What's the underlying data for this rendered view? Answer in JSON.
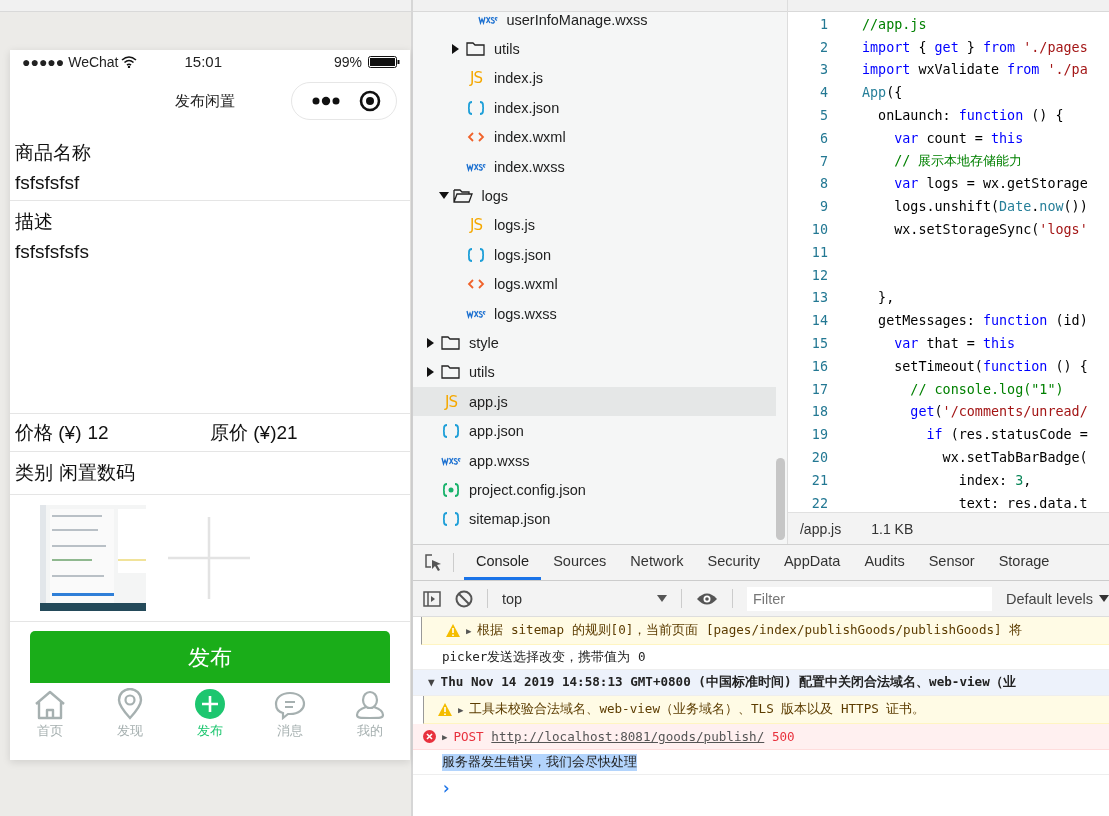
{
  "simulator": {
    "status_bar": {
      "carrier": "●●●●● WeChat",
      "time": "15:01",
      "battery": "99%"
    },
    "nav_bar": {
      "title": "发布闲置"
    },
    "form": {
      "name_field": {
        "label": "商品名称",
        "value": "fsfsfsfsf"
      },
      "description_field": {
        "label": "描述",
        "value": "fsfsfsfsfs"
      },
      "price_field": {
        "label": "价格 (¥)",
        "value": "12"
      },
      "original_price_field": {
        "label": "原价 (¥)",
        "value": "21"
      },
      "category_field": {
        "label": "类别",
        "value": "闲置数码"
      },
      "submit_button": "发布"
    },
    "tab_bar": [
      {
        "label": "首页",
        "selected": false
      },
      {
        "label": "发现",
        "selected": false
      },
      {
        "label": "发布",
        "selected": true
      },
      {
        "label": "消息",
        "selected": false
      },
      {
        "label": "我的",
        "selected": false
      }
    ]
  },
  "file_tree": [
    [
      [
        [
          {
            "kind": "wxss",
            "label": "userInfoManage.wxss",
            "selected": false
          }
        ],
        {
          "kind": "folder",
          "label": "utils",
          "expanded": false,
          "selected": false
        },
        {
          "kind": "js",
          "badge": "JS",
          "label": "index.js",
          "selected": false
        },
        {
          "kind": "json",
          "label": "index.json",
          "selected": false
        },
        {
          "kind": "wxml",
          "label": "index.wxml",
          "selected": false
        },
        {
          "kind": "wxss",
          "label": "index.wxss",
          "selected": false
        }
      ],
      {
        "kind": "folder",
        "label": "logs",
        "expanded": true,
        "selected": false,
        "children": [
          {
            "kind": "js",
            "badge": "JS",
            "label": "logs.js",
            "selected": false
          },
          {
            "kind": "json",
            "label": "logs.json",
            "selected": false
          },
          {
            "kind": "wxml",
            "label": "logs.wxml",
            "selected": false
          },
          {
            "kind": "wxss",
            "label": "logs.wxss",
            "selected": false
          }
        ]
      }
    ],
    {
      "kind": "folder",
      "label": "style",
      "expanded": false,
      "selected": false
    },
    {
      "kind": "folder",
      "label": "utils",
      "expanded": false,
      "selected": false
    },
    {
      "kind": "js",
      "badge": "JS",
      "label": "app.js",
      "selected": true
    },
    {
      "kind": "json",
      "label": "app.json",
      "selected": false
    },
    {
      "kind": "wxss",
      "label": "app.wxss",
      "selected": false
    },
    {
      "kind": "config",
      "label": "project.config.json",
      "selected": false
    },
    {
      "kind": "json",
      "label": "sitemap.json",
      "selected": false
    }
  ],
  "editor": {
    "lines": [
      {
        "number": "1",
        "tokens": [
          {
            "kind": "comment",
            "text": "//app.js"
          }
        ]
      },
      {
        "number": "2",
        "tokens": [
          {
            "kind": "keyword",
            "text": "import"
          },
          {
            "kind": "plain",
            "text": " { "
          },
          {
            "kind": "keyword",
            "text": "get"
          },
          {
            "kind": "plain",
            "text": " } "
          },
          {
            "kind": "keyword",
            "text": "from "
          },
          {
            "kind": "string",
            "text": "'./pages"
          }
        ]
      },
      {
        "number": "3",
        "tokens": [
          {
            "kind": "keyword",
            "text": "import"
          },
          {
            "kind": "plain",
            "text": " wxValidate "
          },
          {
            "kind": "keyword",
            "text": "from "
          },
          {
            "kind": "string",
            "text": "'./pa"
          }
        ]
      },
      {
        "number": "4",
        "tokens": [
          {
            "kind": "builtin",
            "text": "App"
          },
          {
            "kind": "plain",
            "text": "({"
          }
        ]
      },
      {
        "number": "5",
        "tokens": [
          {
            "kind": "plain",
            "text": "  onLaunch: "
          },
          {
            "kind": "keyword",
            "text": "function"
          },
          {
            "kind": "plain",
            "text": " () {"
          }
        ]
      },
      {
        "number": "6",
        "tokens": [
          {
            "kind": "keyword",
            "text": "    var"
          },
          {
            "kind": "plain",
            "text": " count = "
          },
          {
            "kind": "keyword",
            "text": "this"
          }
        ]
      },
      {
        "number": "7",
        "tokens": [
          {
            "kind": "comment",
            "text": "    // 展示本地存储能力"
          }
        ]
      },
      {
        "number": "8",
        "tokens": [
          {
            "kind": "keyword",
            "text": "    var"
          },
          {
            "kind": "plain",
            "text": " logs = wx.getStorage"
          }
        ]
      },
      {
        "number": "9",
        "tokens": [
          {
            "kind": "plain",
            "text": "    logs.unshift("
          },
          {
            "kind": "builtin",
            "text": "Date"
          },
          {
            "kind": "plain",
            "text": "."
          },
          {
            "kind": "builtin",
            "text": "now"
          },
          {
            "kind": "plain",
            "text": "())"
          }
        ]
      },
      {
        "number": "10",
        "tokens": [
          {
            "kind": "plain",
            "text": "    wx.setStorageSync("
          },
          {
            "kind": "string",
            "text": "'logs'"
          }
        ]
      },
      {
        "number": "11"
      },
      {
        "number": "12"
      },
      {
        "number": "13",
        "tokens": [
          {
            "kind": "plain",
            "text": "  },"
          }
        ]
      },
      {
        "number": "14",
        "tokens": [
          {
            "kind": "plain",
            "text": "  getMessages: "
          },
          {
            "kind": "keyword",
            "text": "function"
          },
          {
            "kind": "plain",
            "text": " (id)"
          }
        ]
      },
      {
        "number": "15",
        "tokens": [
          {
            "kind": "keyword",
            "text": "    var"
          },
          {
            "kind": "plain",
            "text": " that = "
          },
          {
            "kind": "keyword",
            "text": "this"
          }
        ]
      },
      {
        "number": "16",
        "tokens": [
          {
            "kind": "plain",
            "text": "    setTimeout("
          },
          {
            "kind": "keyword",
            "text": "function"
          },
          {
            "kind": "plain",
            "text": " () {"
          }
        ]
      },
      {
        "number": "17",
        "tokens": [
          {
            "kind": "comment",
            "text": "      // console.log(\"1\")"
          }
        ]
      },
      {
        "number": "18",
        "tokens": [
          {
            "kind": "keyword",
            "text": "      get"
          },
          {
            "kind": "plain",
            "text": "("
          },
          {
            "kind": "string",
            "text": "'/comments/unread/"
          }
        ]
      },
      {
        "number": "19",
        "tokens": [
          {
            "kind": "keyword",
            "text": "        if"
          },
          {
            "kind": "plain",
            "text": " (res.statusCode ="
          }
        ]
      },
      {
        "number": "20",
        "tokens": [
          {
            "kind": "plain",
            "text": "          wx.setTabBarBadge("
          }
        ]
      },
      {
        "number": "21",
        "tokens": [
          {
            "kind": "plain",
            "text": "            index: "
          },
          {
            "kind": "number",
            "text": "3"
          },
          {
            "kind": "plain",
            "text": ","
          }
        ]
      },
      {
        "number": "22",
        "tokens": [
          {
            "kind": "plain",
            "text": "            text: res.data.t"
          }
        ]
      }
    ],
    "file_path": "/app.js",
    "file_size": "1.1 KB"
  },
  "devtools": {
    "tabs": [
      {
        "label": "Console",
        "selected": true
      },
      {
        "label": "Sources",
        "selected": false
      },
      {
        "label": "Network",
        "selected": false
      },
      {
        "label": "Security",
        "selected": false
      },
      {
        "label": "AppData",
        "selected": false
      },
      {
        "label": "Audits",
        "selected": false
      },
      {
        "label": "Sensor",
        "selected": false
      },
      {
        "label": "Storage",
        "selected": false
      }
    ],
    "context": "top",
    "filter_placeholder": "Filter",
    "levels": "Default levels",
    "messages": [
      {
        "kind": "warning",
        "expander": "▶",
        "text": "根据 sitemap 的规则[0]，当前页面 [pages/index/publishGoods/publishGoods] 将",
        "selected": false
      },
      {
        "kind": "log",
        "text": "picker发送选择改变，携带值为 0",
        "selected": false
      },
      {
        "kind": "group",
        "expander": "▼",
        "text": "Thu Nov 14 2019 14:58:13 GMT+0800 (中国标准时间) 配置中关闭合法域名、web-view（业",
        "selected": false
      },
      {
        "kind": "warning",
        "expander": "▶",
        "text": "工具未校验合法域名、web-view（业务域名）、TLS 版本以及 HTTPS 证书。",
        "selected": false,
        "nested": true
      },
      {
        "kind": "error",
        "expander": "▶",
        "method": "POST",
        "url": "http://localhost:8081/goods/publish/",
        "status": "500",
        "selected": false
      },
      {
        "kind": "log",
        "text": "服务器发生错误，我们会尽快处理",
        "selected": true
      },
      {
        "kind": "prompt",
        "text": "›"
      }
    ]
  }
}
